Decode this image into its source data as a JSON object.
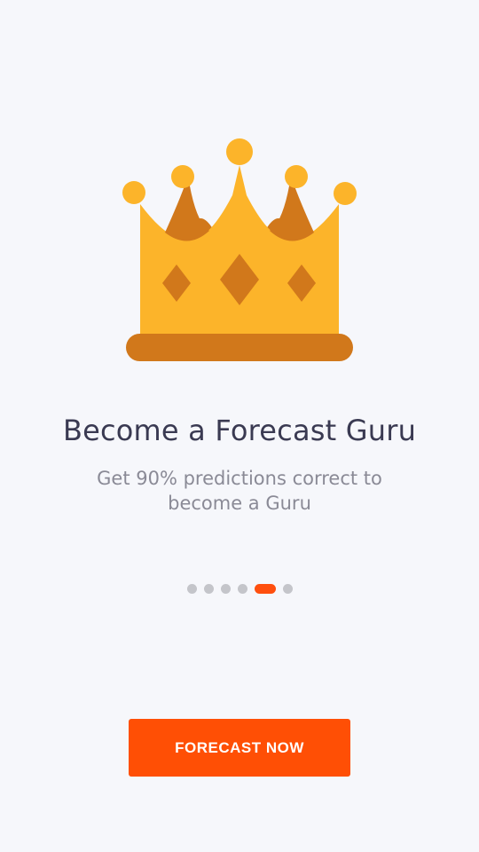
{
  "colors": {
    "background": "#f6f7fb",
    "accent": "#ff4f05",
    "crown_gold": "#fcb42a",
    "crown_shadow": "#d1781b",
    "dot_inactive": "#c4c5ca"
  },
  "hero": {
    "icon": "crown-icon"
  },
  "onboarding": {
    "title": "Become a Forecast Guru",
    "subtitle": "Get 90% predictions correct to become a Guru"
  },
  "pagination": {
    "total": 6,
    "current": 5
  },
  "cta": {
    "label": "FORECAST NOW"
  }
}
